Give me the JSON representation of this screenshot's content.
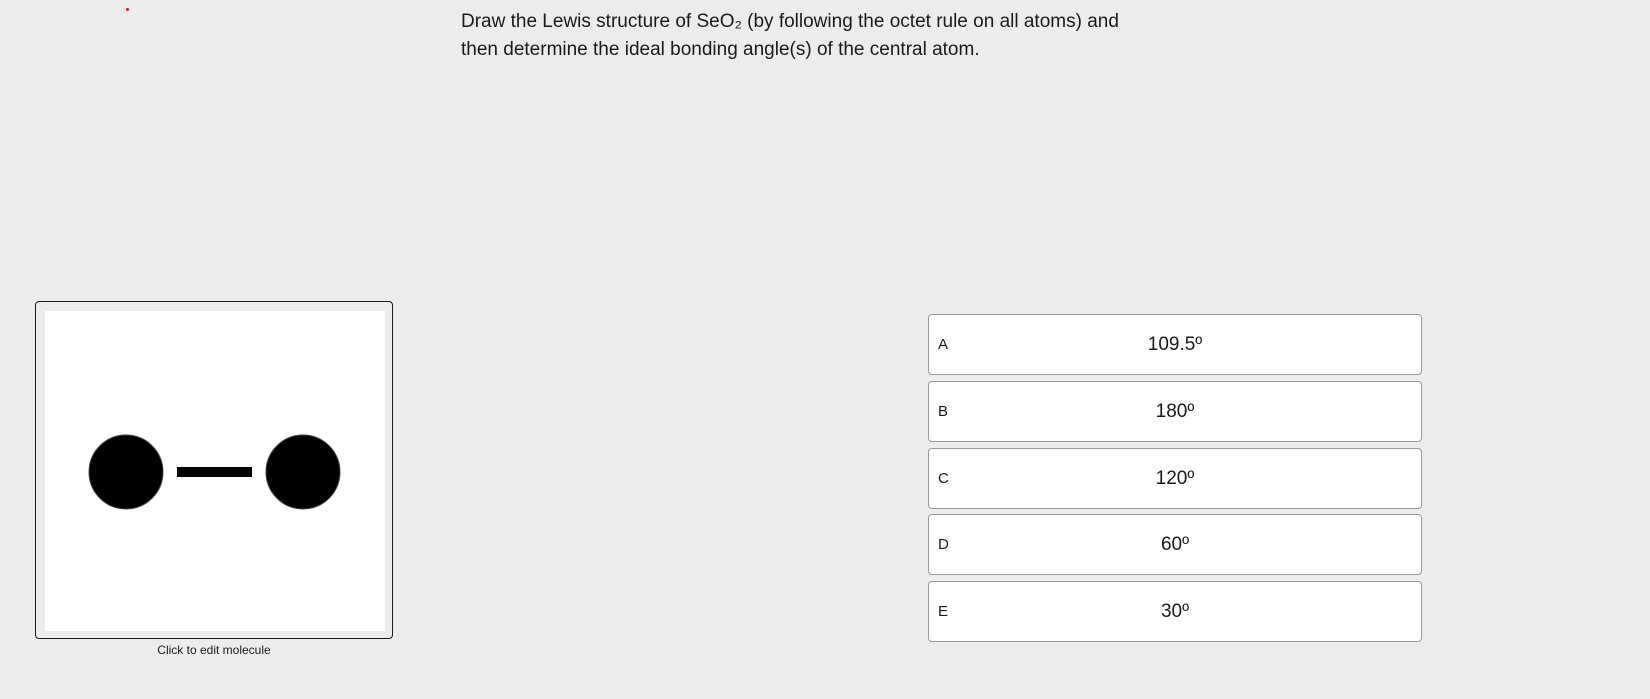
{
  "question": {
    "line1": "Draw the Lewis structure of SeO₂ (by following the octet rule on all atoms) and",
    "line2": "then determine the ideal bonding angle(s) of the central atom."
  },
  "molecule_editor": {
    "caption": "Click to edit molecule"
  },
  "options": [
    {
      "letter": "A",
      "value": "109.5º"
    },
    {
      "letter": "B",
      "value": "180º"
    },
    {
      "letter": "C",
      "value": "120º"
    },
    {
      "letter": "D",
      "value": "60º"
    },
    {
      "letter": "E",
      "value": "30º"
    }
  ],
  "colors": {
    "background": "#ececec",
    "marker_dot": "#e01010",
    "atom": "#000000"
  }
}
